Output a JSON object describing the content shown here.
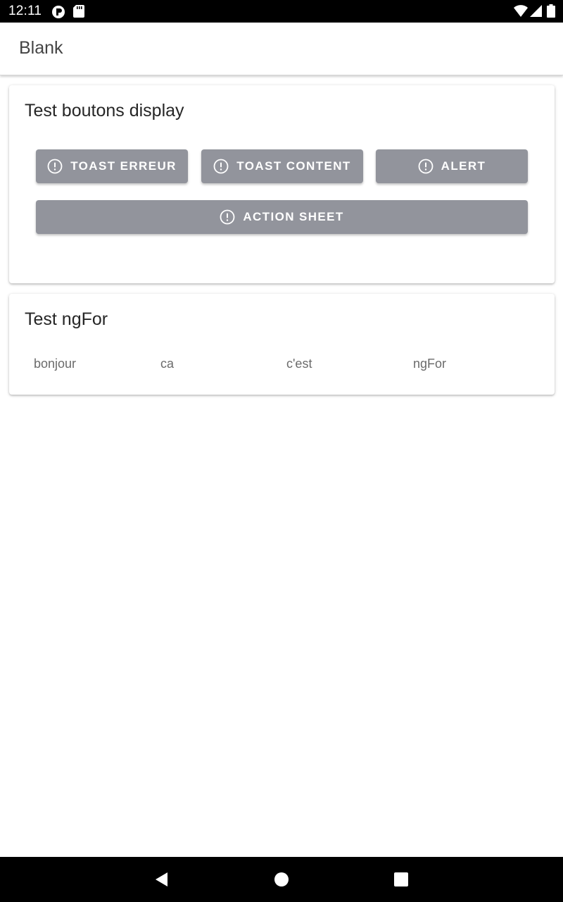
{
  "status_bar": {
    "time": "12:11",
    "left_icons": [
      "app-notification-icon",
      "sd-card-icon"
    ],
    "right_icons": [
      "wifi-icon",
      "cell-signal-icon",
      "battery-icon"
    ]
  },
  "toolbar": {
    "title": "Blank"
  },
  "card_buttons": {
    "title": "Test boutons display",
    "buttons": [
      {
        "label": "TOAST ERREUR",
        "icon": "alert-circle-icon"
      },
      {
        "label": "TOAST CONTENT",
        "icon": "alert-circle-icon"
      },
      {
        "label": "ALERT",
        "icon": "alert-circle-icon"
      },
      {
        "label": "ACTION SHEET",
        "icon": "alert-circle-icon"
      }
    ],
    "button_color": "#92949c"
  },
  "card_ngfor": {
    "title": "Test ngFor",
    "items": [
      "bonjour",
      "ca",
      "c'est",
      "ngFor"
    ]
  },
  "nav_bar": {
    "buttons": [
      "back-icon",
      "home-icon",
      "recents-icon"
    ]
  }
}
